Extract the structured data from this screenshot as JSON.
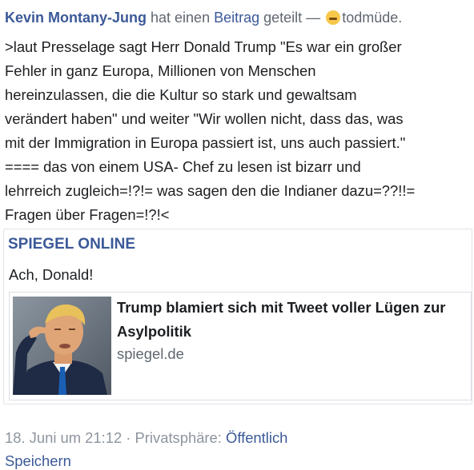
{
  "post": {
    "author": "Kevin Montany-Jung",
    "verb_part1": " hat einen ",
    "post_link": "Beitrag",
    "verb_part2": " geteilt — ",
    "feeling_icon": "sleepy-face-emoji",
    "feeling": "todmüde.",
    "body_lines": [
      ">laut Presselage sagt Herr Donald Trump \"Es war ein großer",
      "Fehler in ganz Europa, Millionen von Menschen",
      "hereinzulassen, die die Kultur so stark und gewaltsam",
      "verändert haben\" und weiter \"Wir wollen nicht, dass das, was",
      "mit der Immigration in Europa passiert ist, uns auch passiert.\"",
      "==== das von einem USA- Chef zu lesen ist bizarr und",
      "lehrreich zugleich=!?!= was sagen den die Indianer dazu=??!!=",
      "Fragen über Fragen=!?!<"
    ]
  },
  "shared": {
    "page_name": "SPIEGEL ONLINE",
    "text": "Ach, Donald!",
    "link": {
      "title_line1": "Trump blamiert sich mit Tweet voller Lügen zur",
      "title_line2": "Asylpolitik",
      "domain": "spiegel.de",
      "thumbnail": "man-pointing-at-temple-photo"
    }
  },
  "footer": {
    "date": "18. Juni um 21:12 · Privatsphäre: ",
    "privacy": "Öffentlich",
    "save_label": "Speichern"
  }
}
